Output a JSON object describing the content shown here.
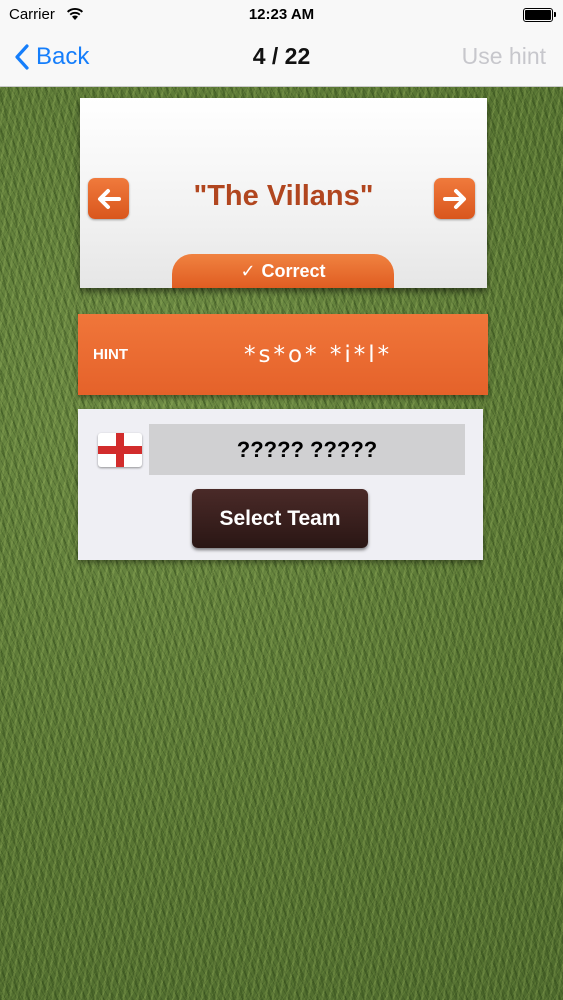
{
  "status_bar": {
    "carrier": "Carrier",
    "time": "12:23 AM"
  },
  "nav": {
    "back_label": "Back",
    "title": "4 / 22",
    "use_hint_label": "Use hint"
  },
  "question": {
    "text": "\"The Villans\"",
    "correct_label": "Correct",
    "check_glyph": "✓"
  },
  "hint": {
    "label": "HINT",
    "text": "*s*o* *i*l*"
  },
  "answer": {
    "value": "????? ?????",
    "select_team_label": "Select Team"
  },
  "colors": {
    "accent_orange": "#e8692e",
    "question_text": "#b1461f",
    "ios_blue": "#157efb",
    "button_dark": "#3a201e"
  },
  "icons": {
    "back": "chevron-left-icon",
    "prev": "arrow-left-icon",
    "next": "arrow-right-icon",
    "flag": "england-flag-icon",
    "wifi": "wifi-icon",
    "battery": "battery-icon"
  }
}
